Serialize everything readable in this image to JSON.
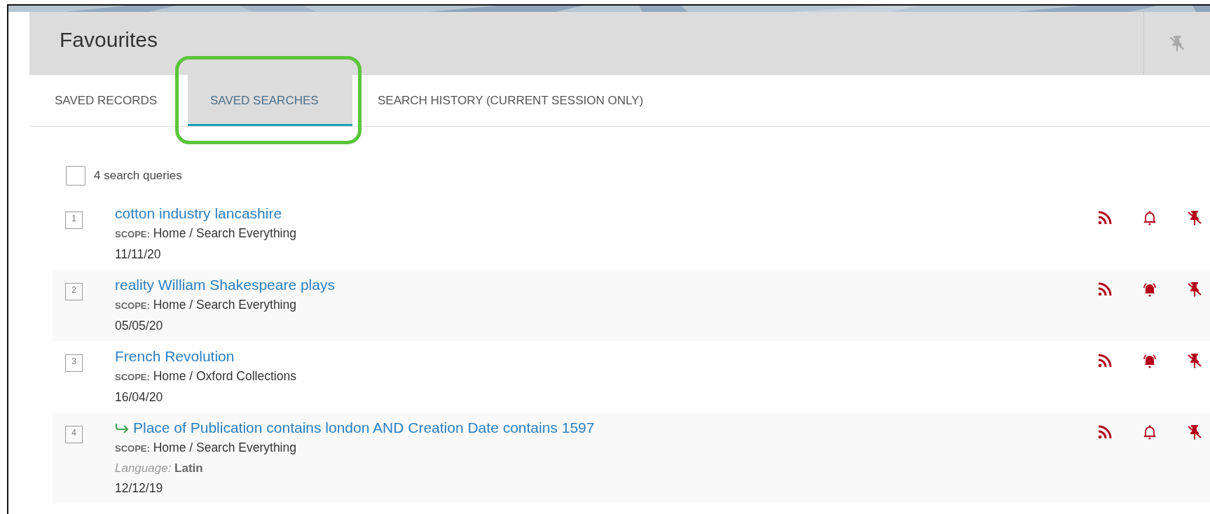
{
  "header": {
    "title": "Favourites"
  },
  "tabs": [
    {
      "label": "SAVED RECORDS",
      "selected": false
    },
    {
      "label": "SAVED SEARCHES",
      "selected": true
    },
    {
      "label": "SEARCH HISTORY (CURRENT SESSION ONLY)",
      "selected": false
    }
  ],
  "list": {
    "count_label": "4 search queries",
    "select_all_checked": false
  },
  "searches": [
    {
      "number": "1",
      "query": "cotton industry lancashire",
      "advanced": false,
      "scope": "**SCOPE:** Home / Search Everything",
      "date": "11/11/20",
      "alert_on": false
    },
    {
      "number": "2",
      "query": "reality William Shakespeare plays",
      "advanced": false,
      "scope": "**SCOPE:** Home / Search Everything",
      "date": "05/05/20",
      "alert_on": true
    },
    {
      "number": "3",
      "query": "French Revolution",
      "advanced": false,
      "scope": "**SCOPE:** Home / Oxford Collections",
      "date": "16/04/20",
      "alert_on": true
    },
    {
      "number": "4",
      "query": "Place of Publication contains london AND Creation Date contains 1597",
      "advanced": true,
      "scope": "**SCOPE:** Home / Search Everything",
      "filters": [
        "*Language:* **Latin**"
      ],
      "date": "12/12/19",
      "alert_on": false
    }
  ]
}
